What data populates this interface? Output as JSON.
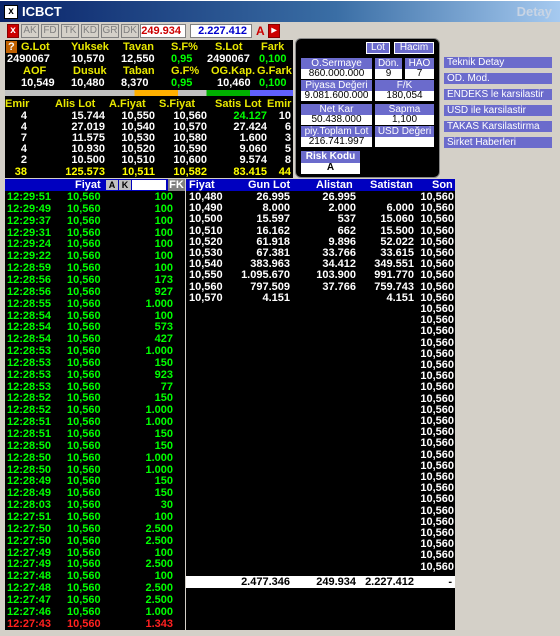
{
  "window": {
    "title": "ICBCT",
    "right_label": "Detay"
  },
  "toolbar": {
    "buttons": [
      "AK",
      "FD",
      "TK",
      "KD",
      "GR",
      "DK"
    ],
    "price": "249.934",
    "volume": "2.227.412",
    "a_label": "A"
  },
  "summary": {
    "headers": [
      "G.Lot",
      "Yuksek",
      "Tavan",
      "S.F%",
      "S.Lot",
      "Fark"
    ],
    "values": [
      "2490067",
      "10,570",
      "12,550",
      "0,95",
      "2490067",
      "0,100"
    ],
    "headers2": [
      "AOF",
      "Dusuk",
      "Taban",
      "G.F%",
      "OG.Kap.",
      "G.Fark"
    ],
    "values2": [
      "10,549",
      "10,480",
      "8,370",
      "0,95",
      "10,460",
      "0,100"
    ]
  },
  "depth": {
    "headers": [
      "Emir",
      "Alis Lot",
      "A.Fiyat",
      "S.Fiyat",
      "Satis Lot",
      "Emir"
    ],
    "rows": [
      [
        "4",
        "15.744",
        "10,550",
        "10,560",
        "24.127",
        "10"
      ],
      [
        "4",
        "27.019",
        "10,540",
        "10,570",
        "27.424",
        "6"
      ],
      [
        "7",
        "11.575",
        "10,530",
        "10,580",
        "1.600",
        "3"
      ],
      [
        "4",
        "10.930",
        "10,520",
        "10,590",
        "9.060",
        "5"
      ],
      [
        "2",
        "10.500",
        "10,510",
        "10,600",
        "9.574",
        "8"
      ]
    ],
    "total": [
      "38",
      "125.573",
      "10,511",
      "10,582",
      "83.415",
      "44"
    ]
  },
  "info_panel": {
    "tabs": [
      "Lot",
      "Hacim"
    ],
    "o_sermaye_label": "O.Sermaye",
    "o_sermaye": "860.000.000",
    "don_label": "Dön.",
    "don": "9",
    "hao_label": "HAO",
    "hao": "7",
    "piyasa_label": "Piyasa Değeri",
    "piyasa": "9.081.600.000",
    "fk_label": "F/K",
    "fk": "180,054",
    "netkar_label": "Net Kar",
    "netkar": "50.438.000",
    "sapma_label": "Sapma",
    "sapma": "1,100",
    "toplam_label": "piy.Toplam Lot",
    "toplam": "216.741.997",
    "usd_label": "USD Değeri",
    "risk_label": "Risk Kodu",
    "risk": "A"
  },
  "side_menu": [
    "Teknik Detay",
    "OD. Mod.",
    "ENDEKS le karsilastir",
    "USD ile karsilastir",
    "TAKAS Karsilastirma",
    "Sirket Haberleri"
  ],
  "trades": {
    "headers": [
      "Fiyat",
      "A",
      "K",
      "FK"
    ],
    "rows": [
      [
        "12:29:51",
        "10,560",
        "100"
      ],
      [
        "12:29:49",
        "10,560",
        "100"
      ],
      [
        "12:29:37",
        "10,560",
        "100"
      ],
      [
        "12:29:31",
        "10,560",
        "100"
      ],
      [
        "12:29:24",
        "10,560",
        "100"
      ],
      [
        "12:29:22",
        "10,560",
        "100"
      ],
      [
        "12:28:59",
        "10,560",
        "100"
      ],
      [
        "12:28:56",
        "10,560",
        "173"
      ],
      [
        "12:28:56",
        "10,560",
        "927"
      ],
      [
        "12:28:55",
        "10,560",
        "1.000"
      ],
      [
        "12:28:54",
        "10,560",
        "100"
      ],
      [
        "12:28:54",
        "10,560",
        "573"
      ],
      [
        "12:28:54",
        "10,560",
        "427"
      ],
      [
        "12:28:53",
        "10,560",
        "1.000"
      ],
      [
        "12:28:53",
        "10,560",
        "150"
      ],
      [
        "12:28:53",
        "10,560",
        "923"
      ],
      [
        "12:28:53",
        "10,560",
        "77"
      ],
      [
        "12:28:52",
        "10,560",
        "150"
      ],
      [
        "12:28:52",
        "10,560",
        "1.000"
      ],
      [
        "12:28:51",
        "10,560",
        "1.000"
      ],
      [
        "12:28:51",
        "10,560",
        "150"
      ],
      [
        "12:28:50",
        "10,560",
        "150"
      ],
      [
        "12:28:50",
        "10,560",
        "1.000"
      ],
      [
        "12:28:50",
        "10,560",
        "1.000"
      ],
      [
        "12:28:49",
        "10,560",
        "150"
      ],
      [
        "12:28:49",
        "10,560",
        "150"
      ],
      [
        "12:28:03",
        "10,560",
        "30"
      ],
      [
        "12:27:51",
        "10,560",
        "100"
      ],
      [
        "12:27:50",
        "10,560",
        "2.500"
      ],
      [
        "12:27:50",
        "10,560",
        "2.500"
      ],
      [
        "12:27:49",
        "10,560",
        "100"
      ],
      [
        "12:27:49",
        "10,560",
        "2.500"
      ],
      [
        "12:27:48",
        "10,560",
        "100"
      ],
      [
        "12:27:48",
        "10,560",
        "2.500"
      ],
      [
        "12:27:47",
        "10,560",
        "2.500"
      ],
      [
        "12:27:46",
        "10,560",
        "1.000"
      ],
      [
        "12:27:43",
        "10,560",
        "1.343"
      ]
    ]
  },
  "price_dist": {
    "headers": [
      "Fiyat",
      "Gun Lot",
      "Alistan",
      "Satistan",
      "Son"
    ],
    "rows": [
      [
        "10,480",
        "26.995",
        "26.995",
        ""
      ],
      [
        "10,490",
        "8.000",
        "2.000",
        "6.000"
      ],
      [
        "10,500",
        "15.597",
        "537",
        "15.060"
      ],
      [
        "10,510",
        "16.162",
        "662",
        "15.500"
      ],
      [
        "10,520",
        "61.918",
        "9.896",
        "52.022"
      ],
      [
        "10,530",
        "67.381",
        "33.766",
        "33.615"
      ],
      [
        "10,540",
        "383.963",
        "34.412",
        "349.551"
      ],
      [
        "10,550",
        "1.095.670",
        "103.900",
        "991.770"
      ],
      [
        "10,560",
        "797.509",
        "37.766",
        "759.743"
      ],
      [
        "10,570",
        "4.151",
        "",
        "4.151"
      ]
    ],
    "son": "10,560",
    "totals": [
      "2.477.346",
      "249.934",
      "2.227.412",
      "-"
    ]
  }
}
